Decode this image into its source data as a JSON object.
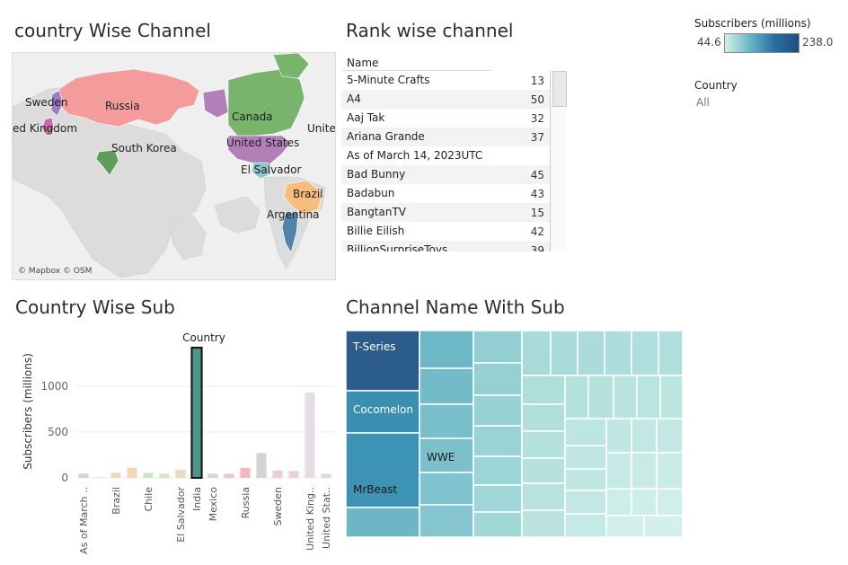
{
  "titles": {
    "map": "country Wise Channel",
    "rank": "Rank wise channel",
    "bars": "Country Wise Sub",
    "treemap": "Channel Name With Sub"
  },
  "map": {
    "labels": [
      "Sweden",
      "Russia",
      "ed Kingdom",
      "South Korea",
      "Canada",
      "Unite",
      "United States",
      "El Salvador",
      "Brazil",
      "Argentina"
    ],
    "credit": "© Mapbox © OSM",
    "colors": {
      "russia": "#f49b9b",
      "canada": "#78b46c",
      "usa": "#b37fb8",
      "greenland": "#78b46c",
      "brazil": "#f7bd7c",
      "argentina": "#4f83a8",
      "india": "#5f9e59",
      "sweden": "#9d7cc3",
      "uk": "#c76ba8",
      "el_salvador": "#8fc6cc",
      "land": "#dcdcdc",
      "ocean": "#efefef"
    }
  },
  "rank_table": {
    "header": "Name",
    "rows": [
      {
        "name": "5-Minute Crafts",
        "rank": "13"
      },
      {
        "name": "A4",
        "rank": "50"
      },
      {
        "name": "Aaj Tak",
        "rank": "32"
      },
      {
        "name": "Ariana Grande",
        "rank": "37"
      },
      {
        "name": "As of March 14, 2023UTC",
        "rank": ""
      },
      {
        "name": "Bad Bunny",
        "rank": "45"
      },
      {
        "name": "Badabun",
        "rank": "43"
      },
      {
        "name": "BangtanTV",
        "rank": "15"
      },
      {
        "name": "Billie Eilish",
        "rank": "42"
      },
      {
        "name": "BillionSurpriseToys",
        "rank": "39"
      }
    ]
  },
  "legend": {
    "title": "Subscribers (millions)",
    "min": "44.6",
    "max": "238.0",
    "colors": [
      "#d4eeea",
      "#69b8c6",
      "#2a70a3",
      "#1d4e7e"
    ]
  },
  "filter": {
    "title": "Country",
    "value": "All"
  },
  "chart_data": {
    "type": "bar",
    "title": "Country Wise Sub",
    "xlabel": "",
    "header": "Country",
    "ylabel": "Subscribers (millions)",
    "ylim": [
      0,
      1450
    ],
    "yticks": [
      0,
      500,
      1000
    ],
    "grid": true,
    "categories": [
      "As of March ..",
      "",
      "Brazil",
      "",
      "Chile",
      "",
      "El Salvador",
      "India",
      "Mexico",
      "",
      "Russia",
      "",
      "Sweden",
      "",
      "United King..",
      "United Stat.."
    ],
    "values": [
      45,
      10,
      55,
      110,
      55,
      45,
      90,
      1420,
      45,
      45,
      110,
      270,
      80,
      75,
      930,
      45
    ],
    "colors": [
      "#c9d6e6",
      "#e8e8e8",
      "#f4d6b8",
      "#f4d6b8",
      "#cde6c9",
      "#cde6c9",
      "#e9dcc4",
      "#4f9686",
      "#d5d5d5",
      "#e9c7c7",
      "#f3b9b9",
      "#d4d4d4",
      "#eecfd1",
      "#eecfd1",
      "#e6dce4",
      "#d5dde8"
    ],
    "highlighted": "India"
  },
  "treemap": {
    "labels": [
      "T-Series",
      "Cocomelon",
      "MrBeast",
      "WWE"
    ]
  }
}
